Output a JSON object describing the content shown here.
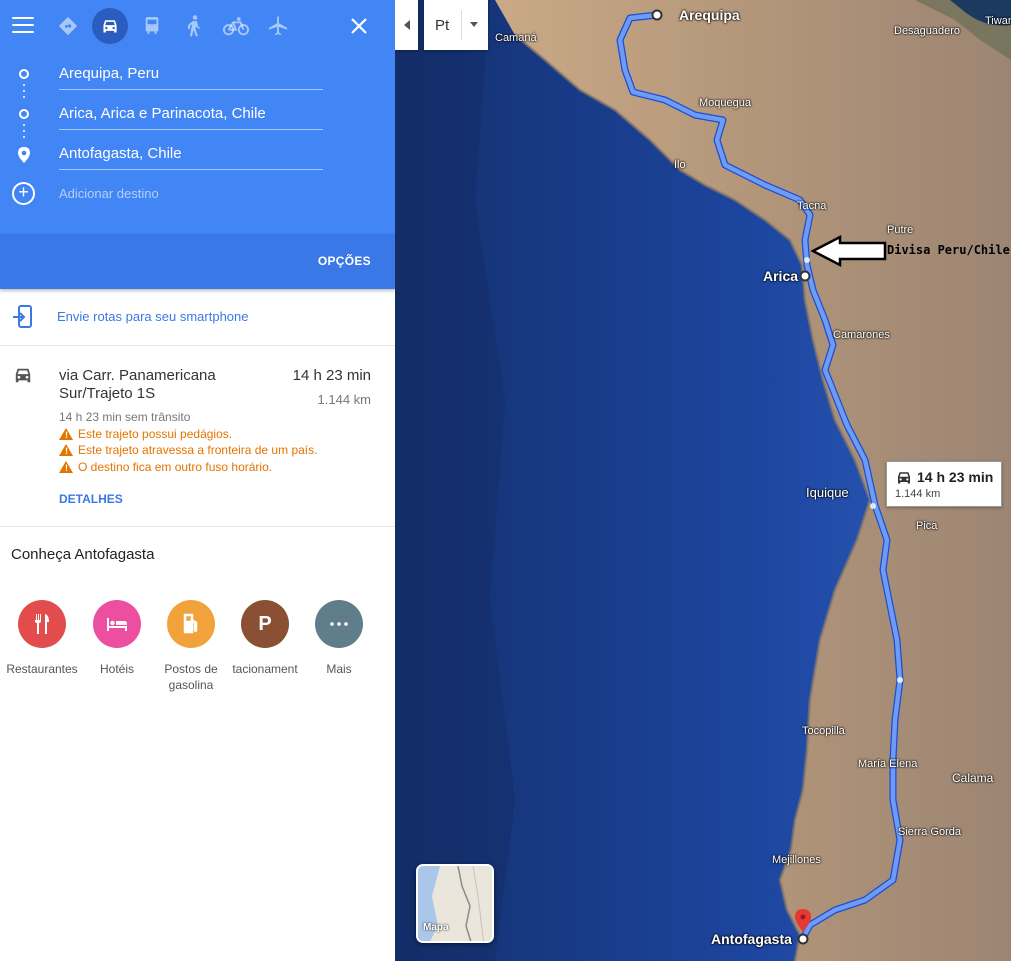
{
  "travel_modes": [
    "best-route",
    "car",
    "transit",
    "walking",
    "cycling",
    "flight"
  ],
  "waypoints": [
    {
      "label": "Arequipa, Peru"
    },
    {
      "label": "Arica, Arica e Parinacota, Chile"
    },
    {
      "label": "Antofagasta, Chile"
    }
  ],
  "add_destination": "Adicionar destino",
  "options_label": "OPÇÕES",
  "send_to_phone": "Envie rotas para seu smartphone",
  "route": {
    "via": "via Carr. Panamericana Sur/Trajeto 1S",
    "time": "14 h 23 min",
    "distance": "1.144 km",
    "no_traffic": "14 h 23 min sem trânsito",
    "warnings": [
      "Este trajeto possui pedágios.",
      "Este trajeto atravessa a fronteira de um país.",
      "O destino fica em outro fuso horário."
    ],
    "details_label": "DETALHES"
  },
  "explore": {
    "title": "Conheça Antofagasta",
    "categories": [
      {
        "label": "Restaurantes",
        "color": "#e24c4c",
        "icon": "restaurant-icon"
      },
      {
        "label": "Hotéis",
        "color": "#ec4fa0",
        "icon": "hotel-icon"
      },
      {
        "label": "Postos de gasolina",
        "color": "#f2a23b",
        "icon": "gas-station-icon"
      },
      {
        "label": "tacionament",
        "color": "#8a5033",
        "icon": "parking-icon"
      },
      {
        "label": "Mais",
        "color": "#607d8b",
        "icon": "more-icon"
      }
    ]
  },
  "map": {
    "language_button": "Pt",
    "minimap_label": "Mapa",
    "annotation": "Divisa Peru/Chile",
    "route_badge": {
      "time": "14 h 23 min",
      "distance": "1.144 km"
    },
    "places": {
      "arequipa": "Arequipa",
      "camana": "Camaná",
      "desaguadero": "Desaguadero",
      "tiwanaku": "Tiwan",
      "moquegua": "Moquegua",
      "ilo": "Ilo",
      "tacna": "Tacna",
      "putre": "Putre",
      "arica": "Arica",
      "camarones": "Camarones",
      "iquique": "Iquique",
      "pica": "Pica",
      "tocopilla": "Tocopilla",
      "maria_elena": "María Elena",
      "calama": "Calama",
      "sierra_gorda": "Sierra Gorda",
      "mejillones": "Mejillones",
      "antofagasta": "Antofagasta"
    },
    "colors": {
      "ocean": "#1b3f8a",
      "land": "#b59a78",
      "route": "#5b8ff0"
    }
  },
  "colors": {
    "header": "#4285f4",
    "accent": "#3b78e7",
    "warning": "#e37400"
  }
}
